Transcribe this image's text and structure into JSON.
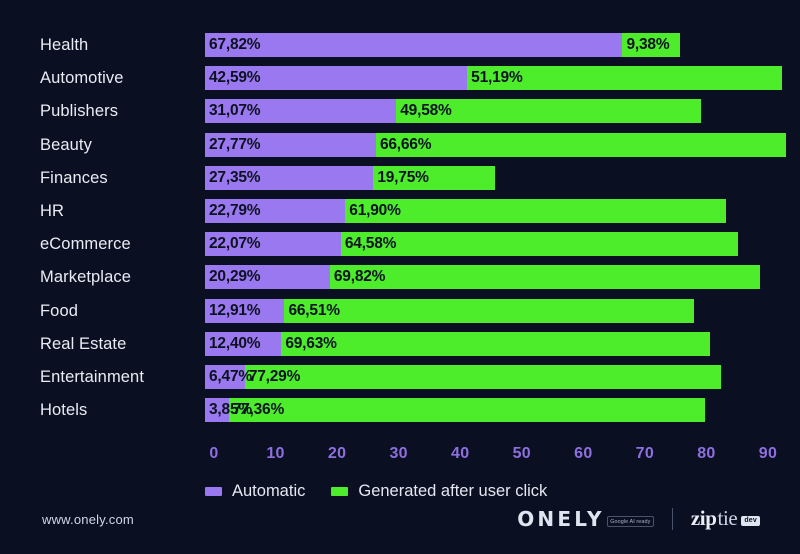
{
  "chart_data": {
    "type": "bar",
    "orientation": "horizontal",
    "stacked": true,
    "title": "",
    "xlabel": "",
    "ylabel": "",
    "xlim": [
      0,
      90
    ],
    "xticks": [
      0,
      10,
      20,
      30,
      40,
      50,
      60,
      70,
      80,
      90
    ],
    "xtick_labels": [
      "0",
      "10",
      "20",
      "30",
      "40",
      "50",
      "60",
      "70",
      "80",
      "90"
    ],
    "grid": false,
    "legend_position": "bottom-left",
    "categories": [
      "Health",
      "Automotive",
      "Publishers",
      "Beauty",
      "Finances",
      "HR",
      "eCommerce",
      "Marketplace",
      "Food",
      "Real Estate",
      "Entertainment",
      "Hotels"
    ],
    "series": [
      {
        "name": "Automatic",
        "color": "#9a78ef",
        "values": [
          67.82,
          42.59,
          31.07,
          27.77,
          27.35,
          22.79,
          22.07,
          20.29,
          12.91,
          12.4,
          6.47,
          3.85
        ],
        "labels": [
          "67,82%",
          "42,59%",
          "31,07%",
          "27,77%",
          "27,35%",
          "22,79%",
          "22,07%",
          "20,29%",
          "12,91%",
          "12,40%",
          "6,47%",
          "3,85%"
        ]
      },
      {
        "name": "Generated after user click",
        "color": "#4ded2b",
        "values": [
          9.38,
          51.19,
          49.58,
          66.66,
          19.75,
          61.9,
          64.58,
          69.82,
          66.51,
          69.63,
          77.29,
          77.36
        ],
        "labels": [
          "9,38%",
          "51,19%",
          "49,58%",
          "66,66%",
          "19,75%",
          "61,90%",
          "64,58%",
          "69,82%",
          "66,51%",
          "69,63%",
          "77,29%",
          "77,36%"
        ]
      }
    ]
  },
  "legend": {
    "items": [
      {
        "label": "Automatic",
        "color": "#9a78ef"
      },
      {
        "label": "Generated after user click",
        "color": "#4ded2b"
      }
    ]
  },
  "footer": {
    "site_url": "www.onely.com",
    "brand_onely": "ONELY",
    "brand_onely_badge": "Google AI ready",
    "brand_ziptie_a": "zip",
    "brand_ziptie_b": "tie",
    "brand_ziptie_badge": "dev"
  },
  "colors": {
    "background": "#0a1021",
    "automatic": "#9a78ef",
    "generated": "#4ded2b",
    "axis_tick": "#8f6fe0",
    "label_text": "#e8ecf4"
  }
}
